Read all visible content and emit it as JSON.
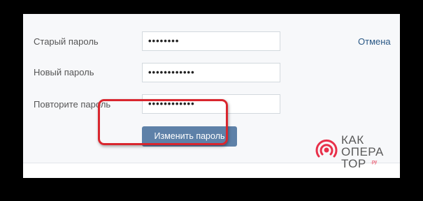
{
  "form": {
    "old_password_label": "Старый пароль",
    "old_password_value": "••••••••",
    "new_password_label": "Новый пароль",
    "new_password_value": "••••••••••••",
    "repeat_password_label": "Повторите пароль",
    "repeat_password_value": "••••••••••••",
    "cancel_label": "Отмена",
    "submit_label": "Изменить пароль"
  },
  "watermark": {
    "line1": "КАК",
    "line2": "ОПЕРА",
    "line3": "ТОР",
    "suffix": ".ру"
  },
  "colors": {
    "accent_button": "#5e81a8",
    "link": "#2a5885",
    "highlight": "#d9262e",
    "logo": "#e8304a"
  }
}
